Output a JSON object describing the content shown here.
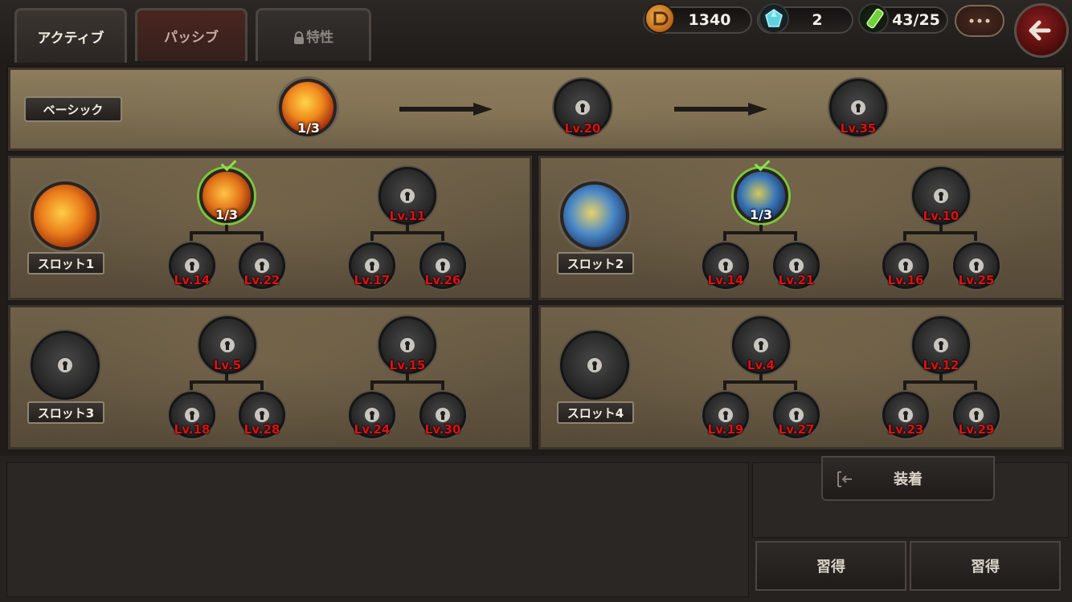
{
  "tabs": [
    {
      "label": "アクティブ"
    },
    {
      "label": "パッシブ"
    },
    {
      "label": "特性"
    }
  ],
  "resources": {
    "coins": "1340",
    "gems": "2",
    "stamina": "43/25"
  },
  "icons": [
    "coin-icon",
    "gem-icon",
    "potion-icon",
    "chat-icon",
    "back-arrow-icon",
    "lock-icon",
    "check-icon"
  ],
  "basic": {
    "label": "ベーシック",
    "first_count": "1/3",
    "unlock_levels": [
      "Lv.20",
      "Lv.35"
    ]
  },
  "slots": [
    {
      "label": "スロット1",
      "branches": [
        {
          "top": "1/3",
          "children": [
            "Lv.14",
            "Lv.22"
          ]
        },
        {
          "top": "Lv.11",
          "children": [
            "Lv.17",
            "Lv.26"
          ]
        }
      ]
    },
    {
      "label": "スロット2",
      "branches": [
        {
          "top": "1/3",
          "children": [
            "Lv.14",
            "Lv.21"
          ]
        },
        {
          "top": "Lv.10",
          "children": [
            "Lv.16",
            "Lv.25"
          ]
        }
      ]
    },
    {
      "label": "スロット3",
      "branches": [
        {
          "top": "Lv.5",
          "children": [
            "Lv.18",
            "Lv.28"
          ]
        },
        {
          "top": "Lv.15",
          "children": [
            "Lv.24",
            "Lv.30"
          ]
        }
      ]
    },
    {
      "label": "スロット4",
      "branches": [
        {
          "top": "Lv.4",
          "children": [
            "Lv.19",
            "Lv.27"
          ]
        },
        {
          "top": "Lv.12",
          "children": [
            "Lv.23",
            "Lv.29"
          ]
        }
      ]
    }
  ],
  "buttons": {
    "equip": "装着",
    "learn_1": "習得",
    "learn_2": "習得"
  },
  "colors": {
    "level_red": "#e20f0f",
    "check_green": "#8de04a",
    "parchment": "#8d7d5e"
  }
}
